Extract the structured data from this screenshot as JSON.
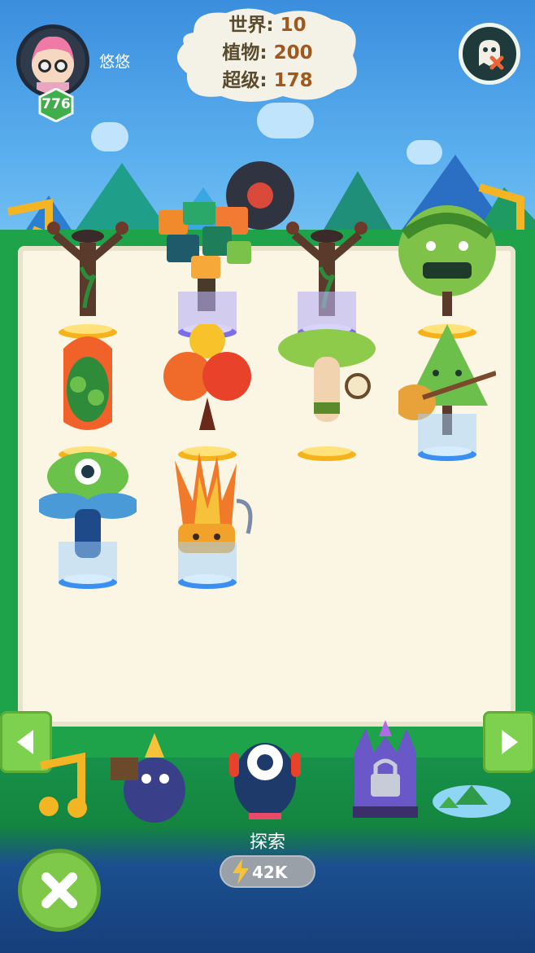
{
  "player": {
    "name": "悠悠",
    "level": "776"
  },
  "stats": {
    "world_label": "世界:",
    "world_value": "10",
    "plants_label": "植物:",
    "plants_value": "200",
    "super_label": "超级:",
    "super_value": "178"
  },
  "collection": {
    "slots": [
      {
        "plant": "drum-tree",
        "pedestal": "gold"
      },
      {
        "plant": "music-block-tree",
        "pedestal": "purple"
      },
      {
        "plant": "drum-tree",
        "pedestal": "purple"
      },
      {
        "plant": "singer-bush",
        "pedestal": "gold"
      },
      {
        "plant": "pepper-pod",
        "pedestal": "gold"
      },
      {
        "plant": "twin-pompom",
        "pedestal": "gold"
      },
      {
        "plant": "mushroom-tambourine",
        "pedestal": "gold"
      },
      {
        "plant": "guitar-pine",
        "pedestal": "blue"
      },
      {
        "plant": "eye-mushroom",
        "pedestal": "blue"
      },
      {
        "plant": "flame-harp",
        "pedestal": "blue"
      }
    ]
  },
  "explore": {
    "label": "探索",
    "cost": "42K"
  },
  "icons": {
    "settings": "ghost-mute-icon",
    "prev": "arrow-left-icon",
    "next": "arrow-right-icon",
    "close": "close-icon",
    "energy": "lightning-icon",
    "locked_world": "lock-icon"
  },
  "colors": {
    "board_frame": "#1ea34a",
    "board": "#fbf5e4",
    "gold_pedestal": "#f5b21a",
    "purple_pedestal": "#7b6ee8",
    "blue_pedestal": "#3a8ff0",
    "stat_value": "#a0581c"
  }
}
